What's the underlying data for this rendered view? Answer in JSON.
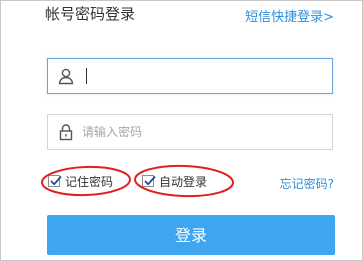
{
  "header": {
    "title": "帐号密码登录",
    "sms_login_link": "短信快捷登录>"
  },
  "username_field": {
    "value": "",
    "icon": "user-icon"
  },
  "password_field": {
    "value": "",
    "placeholder": "请输入密码",
    "icon": "lock-icon"
  },
  "options": {
    "remember_password": {
      "label": "记住密码",
      "checked": true
    },
    "auto_login": {
      "label": "自动登录",
      "checked": true
    },
    "forgot_password_link": "忘记密码?"
  },
  "login_button": {
    "label": "登录"
  },
  "colors": {
    "accent": "#3ea6f0",
    "link": "#2e8fe0",
    "annotation": "#e02020"
  }
}
